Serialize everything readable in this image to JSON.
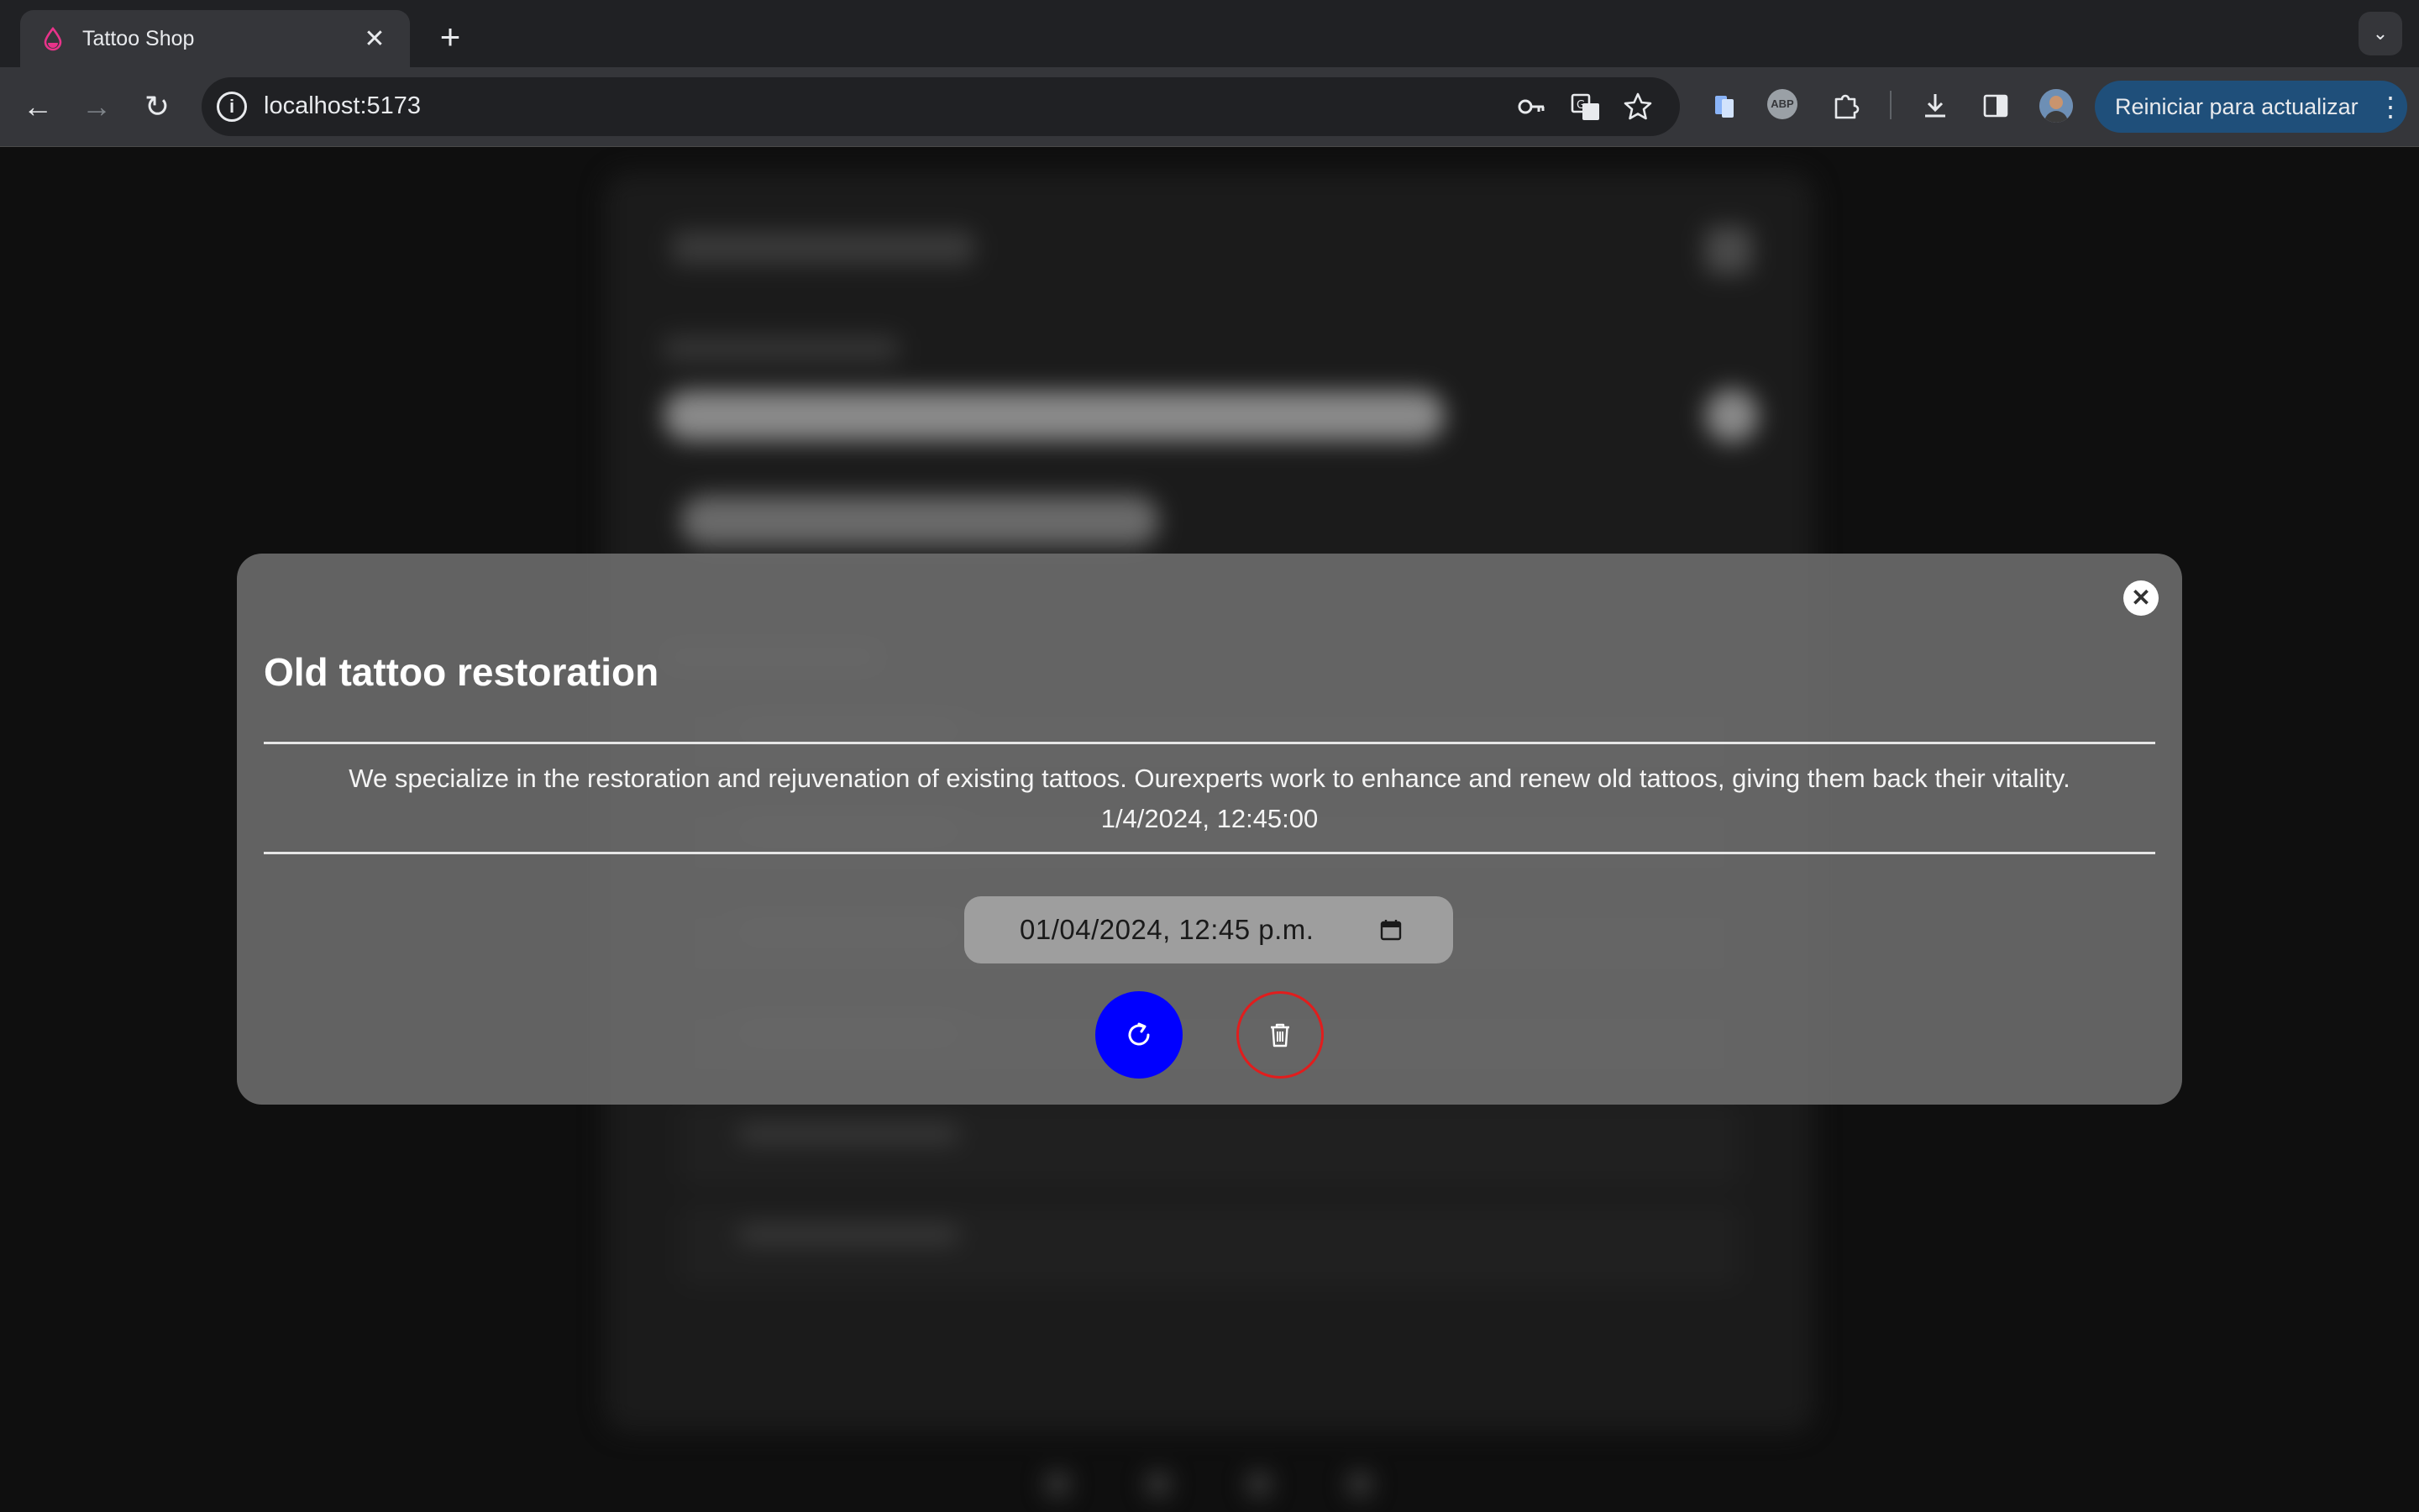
{
  "browser": {
    "tab_title": "Tattoo Shop",
    "tab_close": "✕",
    "new_tab": "+",
    "url": "localhost:5173",
    "update_button_label": "Reiniciar para actualizar",
    "icons": [
      "back-arrow-icon",
      "forward-arrow-icon",
      "reload-icon",
      "site-info-icon",
      "password-key-icon",
      "translate-icon",
      "bookmark-star-icon",
      "extension-icon",
      "adblock-icon",
      "puzzle-icon",
      "download-icon",
      "side-panel-icon",
      "profile-avatar",
      "more-vert-icon"
    ]
  },
  "modal": {
    "title": "Old tattoo restoration",
    "description": "We specialize in the restoration and rejuvenation of existing tattoos. Ourexperts work to enhance and renew old tattoos, giving them back their vitality.",
    "date_text": "1/4/2024, 12:45:00",
    "datetime_value": "01/04/2024, 12:45 p.m.",
    "close_symbol": "✕"
  },
  "colors": {
    "accent_blue": "#0000ff",
    "delete_red": "#e11d1d",
    "update_button_bg": "#1f4f7a",
    "favicon_pink": "#e8338a"
  }
}
